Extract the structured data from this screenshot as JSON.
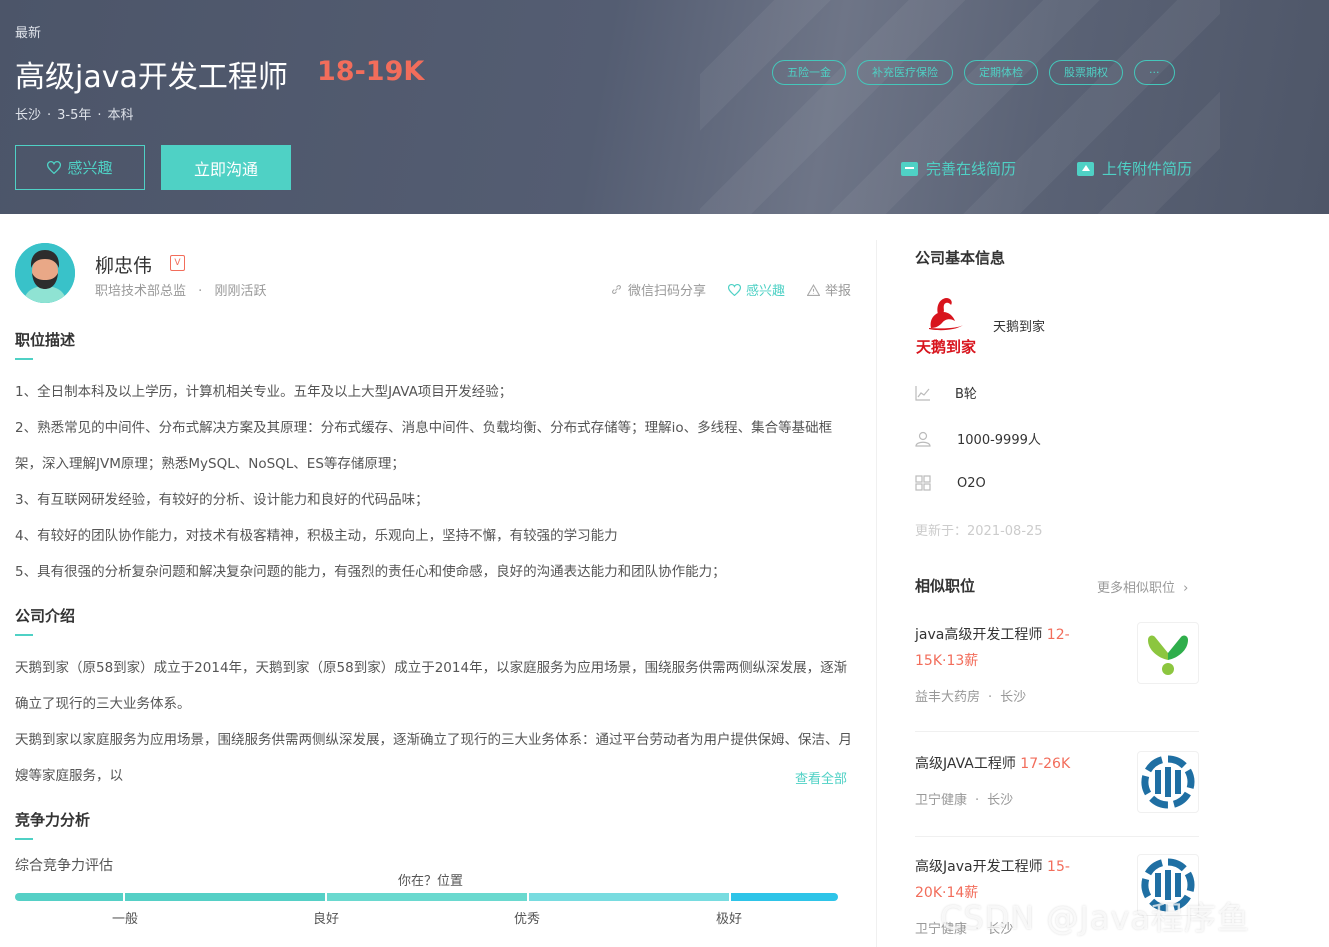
{
  "header": {
    "latest": "最新",
    "title": "高级java开发工程师",
    "salary": "18-19K",
    "city": "长沙",
    "experience": "3-5年",
    "education": "本科",
    "tags": [
      "五险一金",
      "补充医疗保险",
      "定期体检",
      "股票期权",
      "···"
    ],
    "interest_label": "感兴趣",
    "chat_label": "立即沟通",
    "improve_resume_label": "完善在线简历",
    "upload_resume_label": "上传附件简历"
  },
  "recruiter": {
    "name": "柳忠伟",
    "badge": "V",
    "position": "职培技术部总监",
    "status": "刚刚活跃",
    "share_label": "微信扫码分享",
    "interest_label": "感兴趣",
    "report_label": "举报"
  },
  "job_desc": {
    "title": "职位描述",
    "items": [
      "1、全日制本科及以上学历，计算机相关专业。五年及以上大型JAVA项目开发经验；",
      "2、熟悉常见的中间件、分布式解决方案及其原理：分布式缓存、消息中间件、负载均衡、分布式存储等；理解io、多线程、集合等基础框架，深入理解JVM原理；熟悉MySQL、NoSQL、ES等存储原理；",
      "3、有互联网研发经验，有较好的分析、设计能力和良好的代码品味；",
      "4、有较好的团队协作能力，对技术有极客精神，积极主动，乐观向上，坚持不懈，有较强的学习能力",
      "5、具有很强的分析复杂问题和解决复杂问题的能力，有强烈的责任心和使命感，良好的沟通表达能力和团队协作能力；"
    ]
  },
  "company_intro": {
    "title": "公司介绍",
    "p1": "天鹅到家（原58到家）成立于2014年，天鹅到家（原58到家）成立于2014年，以家庭服务为应用场景，围绕服务供需两侧纵深发展，逐渐确立了现行的三大业务体系。",
    "p2": "天鹅到家以家庭服务为应用场景，围绕服务供需两侧纵深发展，逐渐确立了现行的三大业务体系：通过平台劳动者为用户提供保姆、保洁、月嫂等家庭服务，以",
    "view_all": "查看全部"
  },
  "competition": {
    "title": "竞争力分析",
    "subtitle": "综合竞争力评估",
    "position_label": "你在？位置",
    "levels": [
      "一般",
      "良好",
      "优秀",
      "极好"
    ],
    "colors": [
      "#55d0c6",
      "#6ad9cf",
      "#78dce0",
      "#2ec4e8"
    ]
  },
  "company_info": {
    "title": "公司基本信息",
    "logo_text": "天鹅到家",
    "name": "天鹅到家",
    "stage": "B轮",
    "size": "1000-9999人",
    "industry": "O2O",
    "updated": "更新于：2021-08-25"
  },
  "similar": {
    "title": "相似职位",
    "more": "更多相似职位",
    "items": [
      {
        "title": "java高级开发工程师",
        "salary": "12-15K·13薪",
        "company": "益丰大药房",
        "city": "长沙"
      },
      {
        "title": "高级JAVA工程师",
        "salary": "17-26K",
        "company": "卫宁健康",
        "city": "长沙"
      },
      {
        "title": "高级Java开发工程师",
        "salary": "15-20K·14薪",
        "company": "卫宁健康",
        "city": "长沙"
      }
    ]
  },
  "watermark": "CSDN @Java程序鱼",
  "colors": {
    "accent": "#4fd1c5",
    "salary": "#f26d5b",
    "banner": "#505a6d"
  }
}
